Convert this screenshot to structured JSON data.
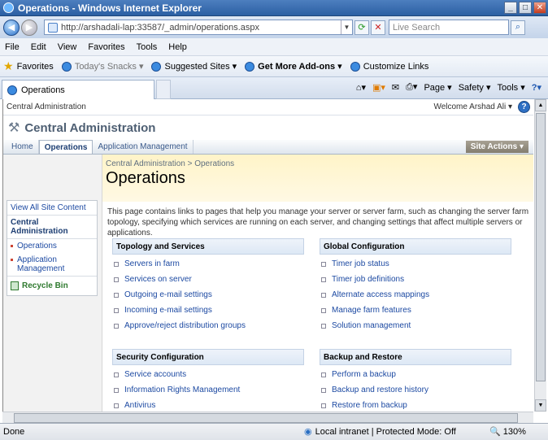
{
  "window": {
    "title": "Operations - Windows Internet Explorer"
  },
  "address": {
    "url": "http://arshadali-lap:33587/_admin/operations.aspx",
    "search_placeholder": "Live Search"
  },
  "menu": [
    "File",
    "Edit",
    "View",
    "Favorites",
    "Tools",
    "Help"
  ],
  "favorites": {
    "label": "Favorites",
    "items": [
      "Today's Snacks ▾",
      "Suggested Sites ▾",
      "Get More Add-ons ▾",
      "Customize Links"
    ]
  },
  "tab": {
    "label": "Operations"
  },
  "commands": [
    "Page ▾",
    "Safety ▾",
    "Tools ▾"
  ],
  "sp": {
    "top": {
      "site": "Central Administration",
      "welcome": "Welcome Arshad Ali ▾"
    },
    "title": "Central Administration",
    "nav": [
      "Home",
      "Operations",
      "Application Management"
    ],
    "site_actions": "Site Actions ▾",
    "breadcrumb": "Central Administration > Operations",
    "page_title": "Operations",
    "intro": "This page contains links to pages that help you manage your server or server farm, such as changing the server farm topology, specifying which services are running on each server, and changing settings that affect multiple servers or applications.",
    "left": {
      "view_all": "View All Site Content",
      "ca": "Central Administration",
      "items": [
        "Operations",
        "Application Management"
      ],
      "recycle": "Recycle Bin"
    },
    "sections": [
      {
        "title": "Topology and Services",
        "links": [
          "Servers in farm",
          "Services on server",
          "Outgoing e-mail settings",
          "Incoming e-mail settings",
          "Approve/reject distribution groups"
        ]
      },
      {
        "title": "Global Configuration",
        "links": [
          "Timer job status",
          "Timer job definitions",
          "Alternate access mappings",
          "Manage farm features",
          "Solution management"
        ]
      },
      {
        "title": "Security Configuration",
        "links": [
          "Service accounts",
          "Information Rights Management",
          "Antivirus"
        ]
      },
      {
        "title": "Backup and Restore",
        "links": [
          "Perform a backup",
          "Backup and restore history",
          "Restore from backup"
        ]
      }
    ]
  },
  "status": {
    "left": "Done",
    "zone": "Local intranet | Protected Mode: Off",
    "zoom": "130%"
  }
}
